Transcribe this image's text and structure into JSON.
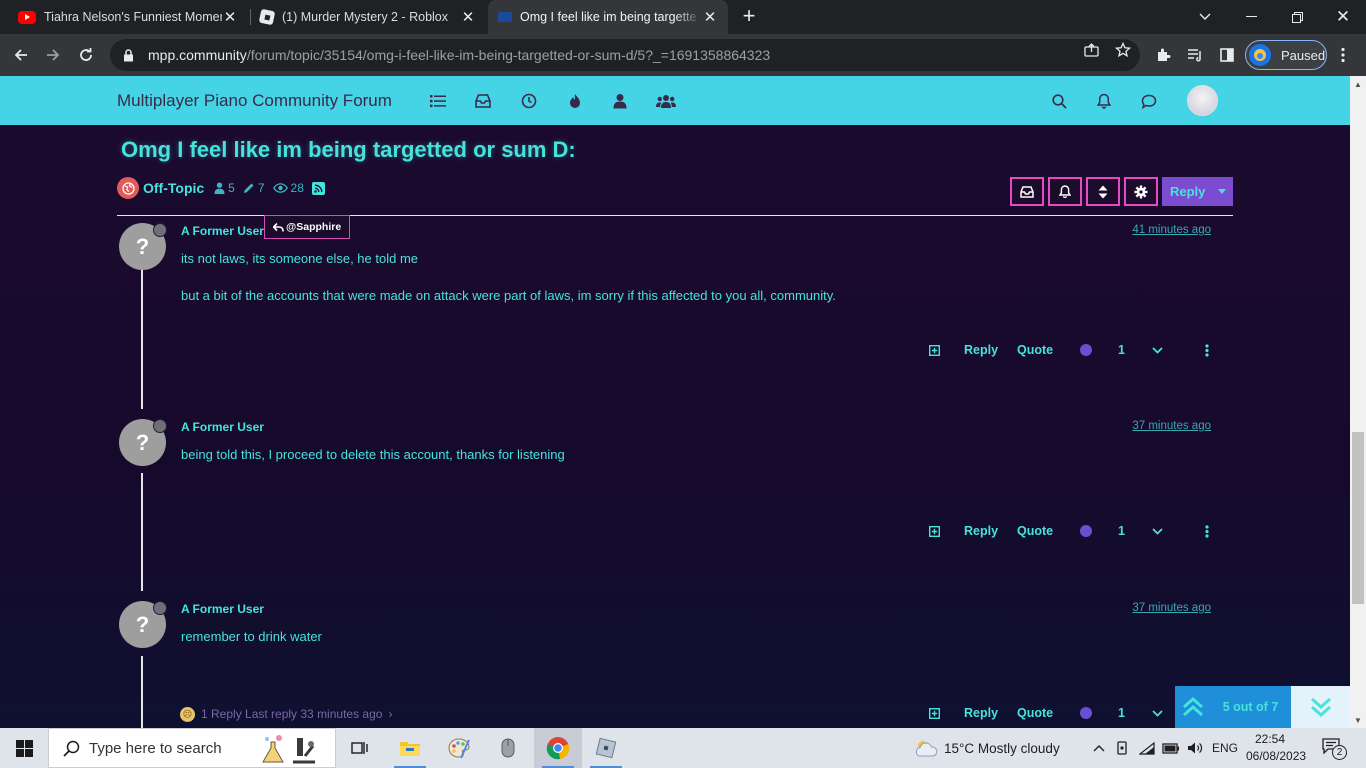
{
  "browser": {
    "tabs": [
      {
        "title": "Tiahra Nelson's Funniest Moment",
        "favicon": "youtube-icon",
        "active": false
      },
      {
        "title": "(1) Murder Mystery 2 - Roblox",
        "favicon": "roblox-icon",
        "active": false
      },
      {
        "title": "Omg I feel like im being targette",
        "favicon": "nodebb-icon",
        "active": true
      }
    ],
    "url_host": "mpp.community",
    "url_path": "/forum/topic/35154/omg-i-feel-like-im-being-targetted-or-sum-d/5?_=1691358864323",
    "profile_label": "Paused"
  },
  "forum": {
    "brand": "Multiplayer Piano Community Forum",
    "nav_icons": [
      "list-icon",
      "inbox-icon",
      "clock-icon",
      "fire-icon",
      "user-icon",
      "users-icon"
    ],
    "right_icons": [
      "search-icon",
      "bell-icon",
      "chat-icon"
    ]
  },
  "topic": {
    "title": "Omg I feel like im being targetted or sum D:",
    "category": "Off-Topic",
    "posters": "5",
    "posts": "7",
    "views": "28",
    "reply_label": "Reply"
  },
  "posts": [
    {
      "author": "A Former User",
      "reply_to": "@Sapphire",
      "time": "41 minutes ago",
      "lines": [
        "its not laws, its someone else, he told me",
        "but a bit of the accounts that were made on attack were part of laws, im sorry if this affected to you all, community."
      ],
      "votes": "1"
    },
    {
      "author": "A Former User",
      "time": "37 minutes ago",
      "lines": [
        "being told this, I proceed to delete this account, thanks for listening"
      ],
      "votes": "1"
    },
    {
      "author": "A Former User",
      "time": "37 minutes ago",
      "lines": [
        "remember to drink water"
      ],
      "votes": "1"
    }
  ],
  "post_actions": {
    "reply": "Reply",
    "quote": "Quote"
  },
  "avatar_letter": "?",
  "reply_summary": "1 Reply Last reply 33 minutes ago",
  "pagination": "5 out of 7",
  "taskbar": {
    "search_placeholder": "Type here to search",
    "weather": "15°C  Mostly cloudy",
    "lang": "ENG",
    "time": "22:54",
    "date": "06/08/2023",
    "notifications": "2"
  },
  "colors": {
    "accent": "#46e3dc",
    "forum_bar": "#45d3e6",
    "pink": "#e64bc2",
    "purple": "#7c4cd0"
  }
}
